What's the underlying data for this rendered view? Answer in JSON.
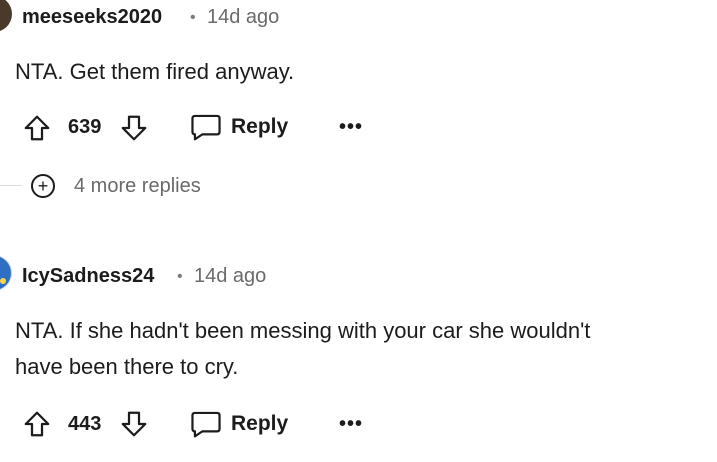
{
  "comments": [
    {
      "username": "meeseeks2020",
      "separator": "•",
      "time": "14d ago",
      "text_lines": [
        "NTA. Get them fired anyway."
      ],
      "votes": "639",
      "reply_label": "Reply",
      "more_label": "•••",
      "more_replies": "4 more replies",
      "expand_symbol": "+"
    },
    {
      "username": "IcySadness24",
      "separator": "•",
      "time": "14d ago",
      "text_lines": [
        "NTA. If she hadn't been messing with your car she wouldn't",
        "have been there to cry."
      ],
      "votes": "443",
      "reply_label": "Reply",
      "more_label": "•••"
    }
  ],
  "colors": {
    "text": "#1c1c1c",
    "meta": "#6a6a6a",
    "line": "#dcdcdc"
  }
}
